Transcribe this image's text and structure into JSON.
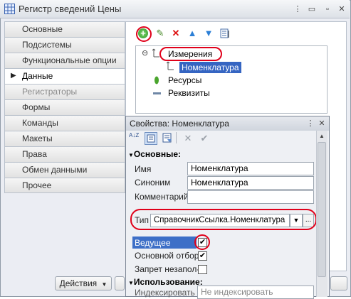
{
  "window": {
    "title": "Регистр сведений Цены",
    "icon": "grid-icon"
  },
  "nav": {
    "items": [
      {
        "label": "Основные",
        "state": "normal"
      },
      {
        "label": "Подсистемы",
        "state": "normal"
      },
      {
        "label": "Функциональные опции",
        "state": "normal"
      },
      {
        "label": "Данные",
        "state": "selected"
      },
      {
        "label": "Регистраторы",
        "state": "disabled"
      },
      {
        "label": "Формы",
        "state": "normal"
      },
      {
        "label": "Команды",
        "state": "normal"
      },
      {
        "label": "Макеты",
        "state": "normal"
      },
      {
        "label": "Права",
        "state": "normal"
      },
      {
        "label": "Обмен данными",
        "state": "normal"
      },
      {
        "label": "Прочее",
        "state": "normal"
      }
    ]
  },
  "tree": {
    "collapse_glyph": "⊖",
    "dimensions_label": "Измерения",
    "nomenclature_label": "Номенклатура",
    "resources_label": "Ресурсы",
    "attributes_label": "Реквизиты"
  },
  "props": {
    "title": "Свойства: Номенклатура",
    "sort_alpha_glyph": "A↓Z",
    "section_main": "Основные:",
    "name_label": "Имя",
    "name_value": "Номенклатура",
    "synonym_label": "Синоним",
    "synonym_value": "Номенклатура",
    "comment_label": "Комментарий",
    "comment_value": "",
    "type_label": "Тип",
    "type_value": "СправочникСсылка.Номенклатура",
    "ellipsis": "...",
    "leading_label": "Ведущее",
    "leading_checked": true,
    "basic_filter_label": "Основной отбор",
    "basic_filter_checked": true,
    "deny_empty_label": "Запрет незапол-",
    "deny_empty_checked": false,
    "section_usage": "Использование:",
    "index_label": "Индексировать",
    "index_value": "Не индексировать"
  },
  "bottom": {
    "actions_label": "Действия"
  },
  "colors": {
    "highlight_red": "#e0001a",
    "selection_blue": "#3565c2",
    "leading_bg": "#3d6fc7"
  }
}
